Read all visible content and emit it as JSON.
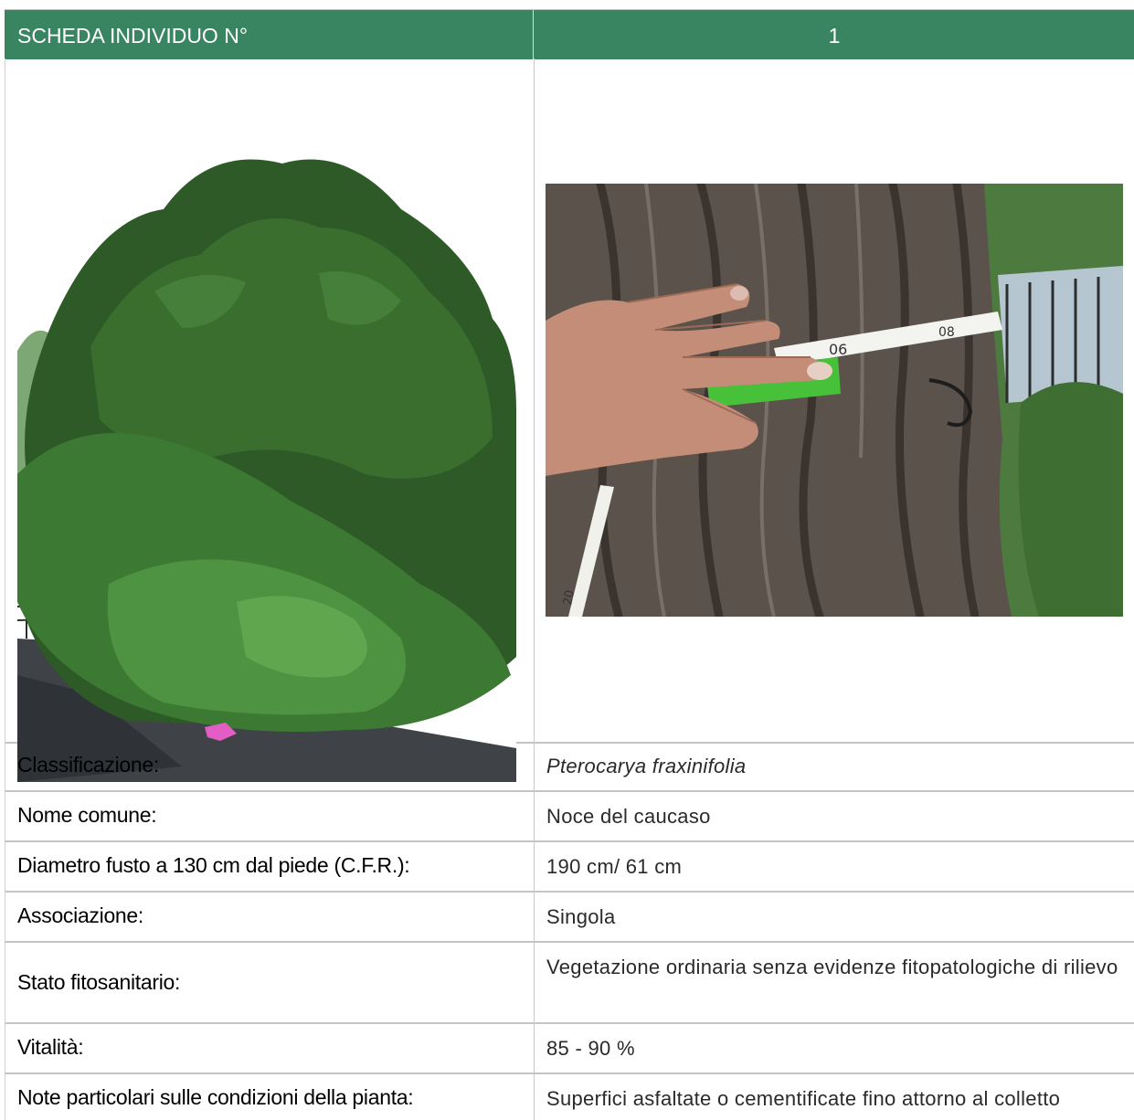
{
  "header": {
    "label": "SCHEDA INDIVIDUO N°",
    "number": "1"
  },
  "photos": {
    "tree": {
      "icon": "tree-photo"
    },
    "bark": {
      "icon": "trunk-measure-photo",
      "tape_marks": [
        "06",
        "08",
        "20"
      ]
    }
  },
  "rows": [
    {
      "key": "Classificazione:",
      "value": "Pterocarya fraxinifolia"
    },
    {
      "key": "Nome comune:",
      "value": "Noce del caucaso"
    },
    {
      "key": "Diametro fusto a 130 cm dal piede (C.F.R.):",
      "value": "190 cm/ 61 cm"
    },
    {
      "key": "Associazione:",
      "value": "Singola"
    },
    {
      "key": "Stato fitosanitario:",
      "value": "Vegetazione ordinaria senza evidenze fitopatologiche di rilievo"
    },
    {
      "key": "Vitalità:",
      "value": "85 - 90 %"
    },
    {
      "key": "Note particolari sulle condizioni della pianta:",
      "value": "Superfici asfaltate o cementificate fino attorno al colletto"
    }
  ],
  "colors": {
    "header_bg": "#3a8561",
    "header_text": "#ffffff",
    "border": "#c4c4c4"
  }
}
